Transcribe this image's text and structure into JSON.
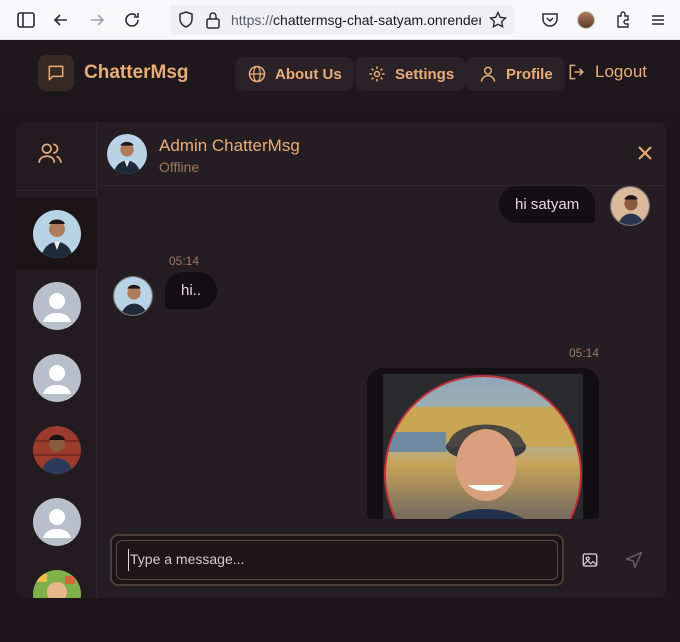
{
  "browser": {
    "url_prefix": "https://",
    "url_host": "chattermsg-chat-satyam.onrender.com"
  },
  "app": {
    "brand": "ChatterMsg",
    "nav": {
      "about": "About Us",
      "settings": "Settings",
      "profile": "Profile",
      "logout": "Logout"
    },
    "accent": "#e9ad7a"
  },
  "chat": {
    "contact_name": "Admin ChatterMsg",
    "contact_status": "Offline",
    "messages": [
      {
        "side": "outgoing",
        "text": "hi satyam",
        "time": ""
      },
      {
        "side": "incoming",
        "text": "hi..",
        "time": "05:14"
      },
      {
        "side": "outgoing",
        "type": "image",
        "time": "05:14"
      }
    ],
    "composer_placeholder": "Type a message..."
  }
}
